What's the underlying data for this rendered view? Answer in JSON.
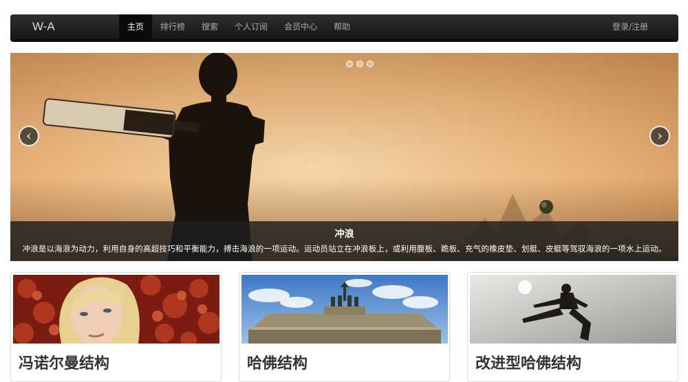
{
  "navbar": {
    "brand": "W-A",
    "items": [
      {
        "label": "主页",
        "active": true
      },
      {
        "label": "排行榜",
        "active": false
      },
      {
        "label": "搜索",
        "active": false
      },
      {
        "label": "个人订阅",
        "active": false
      },
      {
        "label": "会员中心",
        "active": false
      },
      {
        "label": "帮助",
        "active": false
      }
    ],
    "login_label": "登录/注册"
  },
  "carousel": {
    "prev_icon": "‹",
    "next_icon": "›",
    "slide_count": 3,
    "active_slide": 1,
    "caption_title": "冲浪",
    "caption_text": "冲浪是以海浪为动力，利用自身的高超技巧和平衡能力，搏击海浪的一项运动。运动员站立在冲浪板上，或利用腹板、跪板、充气的橡皮垫、划艇、皮艇等驾驭海浪的一项水上运动。"
  },
  "thumbnails": [
    {
      "title": "冯诺尔曼结构"
    },
    {
      "title": "哈佛结构"
    },
    {
      "title": "改进型哈佛结构"
    }
  ]
}
